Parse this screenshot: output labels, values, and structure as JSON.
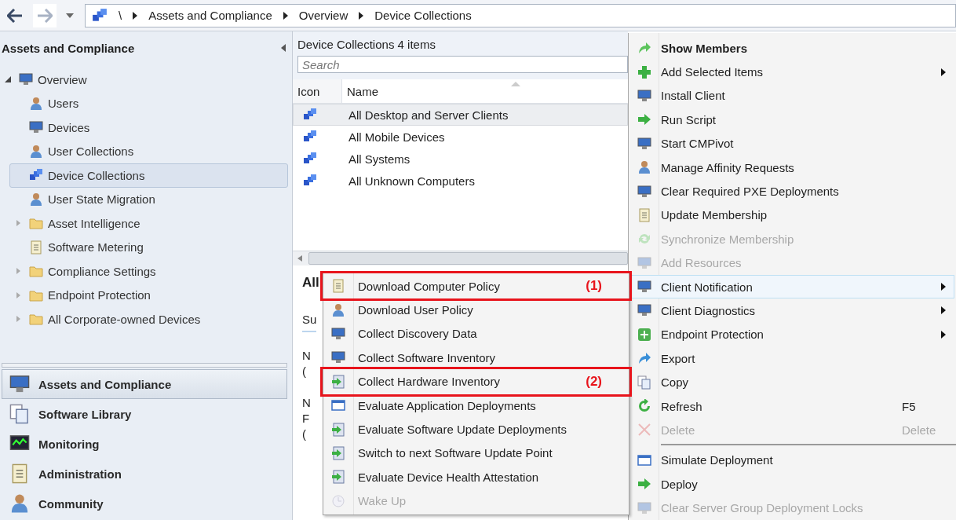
{
  "nav": {
    "path": [
      "\\",
      "Assets and Compliance",
      "Overview",
      "Device Collections"
    ]
  },
  "left": {
    "title": "Assets and Compliance",
    "tree": [
      {
        "label": "Overview",
        "expanded": true,
        "selected": false,
        "children": [
          {
            "label": "Users",
            "selected": false
          },
          {
            "label": "Devices",
            "selected": false
          },
          {
            "label": "User Collections",
            "selected": false
          },
          {
            "label": "Device Collections",
            "selected": true
          },
          {
            "label": "User State Migration",
            "selected": false
          },
          {
            "label": "Asset Intelligence",
            "expanded": false,
            "selected": false
          },
          {
            "label": "Software Metering",
            "selected": false
          },
          {
            "label": "Compliance Settings",
            "expanded": false,
            "selected": false
          },
          {
            "label": "Endpoint Protection",
            "expanded": false,
            "selected": false
          },
          {
            "label": "All Corporate-owned Devices",
            "expanded": false,
            "selected": false
          }
        ]
      }
    ],
    "workspaces": [
      {
        "label": "Assets and Compliance",
        "selected": true
      },
      {
        "label": "Software Library",
        "selected": false
      },
      {
        "label": "Monitoring",
        "selected": false
      },
      {
        "label": "Administration",
        "selected": false
      },
      {
        "label": "Community",
        "selected": false
      }
    ]
  },
  "list": {
    "title": "Device Collections 4 items",
    "search": {
      "placeholder": "Search"
    },
    "columns": [
      "Icon",
      "Name"
    ],
    "rows": [
      {
        "name": "All Desktop and Server Clients",
        "selected": true
      },
      {
        "name": "All Mobile Devices",
        "selected": false
      },
      {
        "name": "All Systems",
        "selected": false
      },
      {
        "name": "All Unknown Computers",
        "selected": false
      }
    ]
  },
  "details": {
    "title": "All",
    "tab": "Su",
    "lines": [
      [
        "N",
        "("
      ],
      [
        "N",
        "F",
        "("
      ]
    ]
  },
  "submenu": [
    {
      "label": "Download Computer Policy",
      "disabled": false,
      "annotation": "(1)"
    },
    {
      "label": "Download User Policy",
      "disabled": false
    },
    {
      "label": "Collect Discovery Data",
      "disabled": false
    },
    {
      "label": "Collect Software Inventory",
      "disabled": false
    },
    {
      "label": "Collect Hardware Inventory",
      "disabled": false,
      "annotation": "(2)"
    },
    {
      "label": "Evaluate Application Deployments",
      "disabled": false
    },
    {
      "label": "Evaluate Software Update Deployments",
      "disabled": false
    },
    {
      "label": "Switch to next Software Update Point",
      "disabled": false
    },
    {
      "label": "Evaluate Device Health Attestation",
      "disabled": false
    },
    {
      "label": "Wake Up",
      "disabled": true
    }
  ],
  "menu": [
    {
      "kind": "item",
      "label": "Show Members",
      "default": true,
      "disabled": false,
      "submenu": false,
      "highlighted": false
    },
    {
      "kind": "item",
      "label": "Add Selected Items",
      "default": false,
      "disabled": false,
      "submenu": true,
      "highlighted": false
    },
    {
      "kind": "item",
      "label": "Install Client",
      "default": false,
      "disabled": false,
      "submenu": false,
      "highlighted": false
    },
    {
      "kind": "item",
      "label": "Run Script",
      "default": false,
      "disabled": false,
      "submenu": false,
      "highlighted": false
    },
    {
      "kind": "item",
      "label": "Start CMPivot",
      "default": false,
      "disabled": false,
      "submenu": false,
      "highlighted": false
    },
    {
      "kind": "item",
      "label": "Manage Affinity Requests",
      "default": false,
      "disabled": false,
      "submenu": false,
      "highlighted": false
    },
    {
      "kind": "item",
      "label": "Clear Required PXE Deployments",
      "default": false,
      "disabled": false,
      "submenu": false,
      "highlighted": false
    },
    {
      "kind": "item",
      "label": "Update Membership",
      "default": false,
      "disabled": false,
      "submenu": false,
      "highlighted": false
    },
    {
      "kind": "item",
      "label": "Synchronize Membership",
      "default": false,
      "disabled": true,
      "submenu": false,
      "highlighted": false
    },
    {
      "kind": "item",
      "label": "Add Resources",
      "default": false,
      "disabled": true,
      "submenu": false,
      "highlighted": false
    },
    {
      "kind": "item",
      "label": "Client Notification",
      "default": false,
      "disabled": false,
      "submenu": true,
      "highlighted": true
    },
    {
      "kind": "item",
      "label": "Client Diagnostics",
      "default": false,
      "disabled": false,
      "submenu": true,
      "highlighted": false
    },
    {
      "kind": "item",
      "label": "Endpoint Protection",
      "default": false,
      "disabled": false,
      "submenu": true,
      "highlighted": false
    },
    {
      "kind": "item",
      "label": "Export",
      "default": false,
      "disabled": false,
      "submenu": false,
      "highlighted": false
    },
    {
      "kind": "item",
      "label": "Copy",
      "default": false,
      "disabled": false,
      "submenu": false,
      "highlighted": false
    },
    {
      "kind": "item",
      "label": "Refresh",
      "shortcut": "F5",
      "default": false,
      "disabled": false,
      "submenu": false,
      "highlighted": false
    },
    {
      "kind": "item",
      "label": "Delete",
      "shortcut": "Delete",
      "default": false,
      "disabled": true,
      "submenu": false,
      "highlighted": false
    },
    {
      "kind": "separator"
    },
    {
      "kind": "item",
      "label": "Simulate Deployment",
      "default": false,
      "disabled": false,
      "submenu": false,
      "highlighted": false
    },
    {
      "kind": "item",
      "label": "Deploy",
      "default": false,
      "disabled": false,
      "submenu": false,
      "highlighted": false
    },
    {
      "kind": "item",
      "label": "Clear Server Group Deployment Locks",
      "default": false,
      "disabled": true,
      "submenu": false,
      "highlighted": false
    }
  ]
}
